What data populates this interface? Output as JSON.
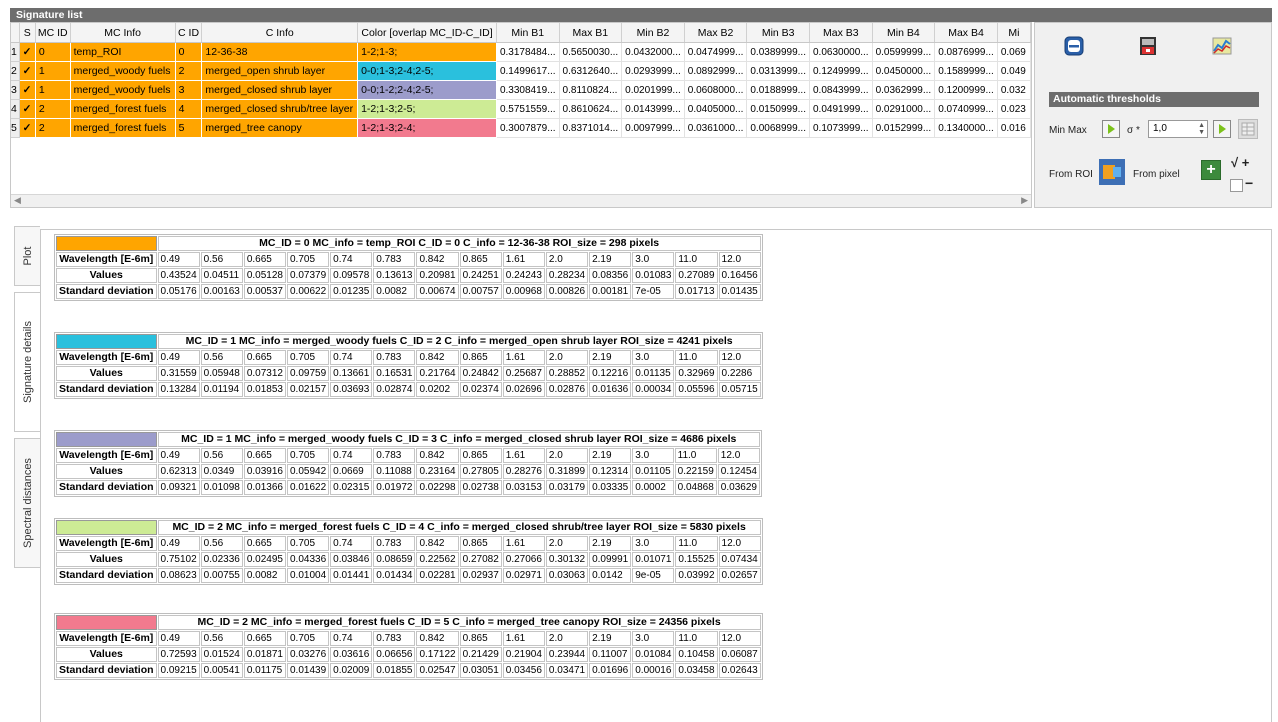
{
  "panel_title": "Signature list",
  "columns": [
    "S",
    "MC ID",
    "MC Info",
    "C ID",
    "C Info",
    "Color [overlap MC_ID-C_ID]",
    "Min B1",
    "Max B1",
    "Min B2",
    "Max B2",
    "Min B3",
    "Max B3",
    "Min B4",
    "Max B4",
    "Mi"
  ],
  "rows": [
    {
      "num": "1",
      "check": "✓",
      "mc_id": "0",
      "mc_info": "temp_ROI",
      "c_id": "0",
      "c_info": "12-36-38",
      "color_text": "1-2;1-3;",
      "color": "#ffa500",
      "mins": [
        "0.3178484...",
        "0.5650030...",
        "0.0432000...",
        "0.0474999...",
        "0.0389999...",
        "0.0630000...",
        "0.0599999...",
        "0.0876999...",
        "0.069"
      ]
    },
    {
      "num": "2",
      "check": "✓",
      "mc_id": "1",
      "mc_info": "merged_woody fuels",
      "c_id": "2",
      "c_info": "merged_open shrub layer",
      "color_text": "0-0;1-3;2-4;2-5;",
      "color": "#2ac0dd",
      "mins": [
        "0.1499617...",
        "0.6312640...",
        "0.0293999...",
        "0.0892999...",
        "0.0313999...",
        "0.1249999...",
        "0.0450000...",
        "0.1589999...",
        "0.049"
      ]
    },
    {
      "num": "3",
      "check": "✓",
      "mc_id": "1",
      "mc_info": "merged_woody fuels",
      "c_id": "3",
      "c_info": "merged_closed shrub layer",
      "color_text": "0-0;1-2;2-4;2-5;",
      "color": "#9c9ccb",
      "mins": [
        "0.3308419...",
        "0.8110824...",
        "0.0201999...",
        "0.0608000...",
        "0.0188999...",
        "0.0843999...",
        "0.0362999...",
        "0.1200999...",
        "0.032"
      ]
    },
    {
      "num": "4",
      "check": "✓",
      "mc_id": "2",
      "mc_info": "merged_forest fuels",
      "c_id": "4",
      "c_info": "merged_closed shrub/tree layer",
      "color_text": "1-2;1-3;2-5;",
      "color": "#cdeb95",
      "mins": [
        "0.5751559...",
        "0.8610624...",
        "0.0143999...",
        "0.0405000...",
        "0.0150999...",
        "0.0491999...",
        "0.0291000...",
        "0.0740999...",
        "0.023"
      ]
    },
    {
      "num": "5",
      "check": "✓",
      "mc_id": "2",
      "mc_info": "merged_forest fuels",
      "c_id": "5",
      "c_info": "merged_tree canopy",
      "color_text": "1-2;1-3;2-4;",
      "color": "#f27a8e",
      "mins": [
        "0.3007879...",
        "0.8371014...",
        "0.0097999...",
        "0.0361000...",
        "0.0068999...",
        "0.1073999...",
        "0.0152999...",
        "0.1340000...",
        "0.016"
      ]
    }
  ],
  "right_panel": {
    "auto_title": "Automatic thresholds",
    "min_max": "Min Max",
    "sigma": "σ *",
    "sigma_value": "1,0",
    "from_roi": "From ROI",
    "from_pixel": "From pixel",
    "check_mark": "√",
    "plus": "+",
    "minus": "−"
  },
  "tabs": [
    "Plot",
    "Signature details",
    "Spectral distances"
  ],
  "row_labels": {
    "wavelength": "Wavelength [E-6m]",
    "values": "Values",
    "std": "Standard deviation"
  },
  "details": [
    {
      "header": "MC_ID = 0 MC_info = temp_ROI C_ID = 0 C_info = 12-36-38 ROI_size = 298 pixels",
      "color": "#ffa500",
      "wavelengths": [
        "0.49",
        "0.56",
        "0.665",
        "0.705",
        "0.74",
        "0.783",
        "0.842",
        "0.865",
        "1.61",
        "2.0",
        "2.19",
        "3.0",
        "11.0",
        "12.0"
      ],
      "values": [
        "0.43524",
        "0.04511",
        "0.05128",
        "0.07379",
        "0.09578",
        "0.13613",
        "0.20981",
        "0.24251",
        "0.24243",
        "0.28234",
        "0.08356",
        "0.01083",
        "0.27089",
        "0.16456"
      ],
      "std": [
        "0.05176",
        "0.00163",
        "0.00537",
        "0.00622",
        "0.01235",
        "0.0082",
        "0.00674",
        "0.00757",
        "0.00968",
        "0.00826",
        "0.00181",
        "7e-05",
        "0.01713",
        "0.01435"
      ]
    },
    {
      "header": "MC_ID = 1 MC_info = merged_woody fuels C_ID = 2 C_info = merged_open shrub layer ROI_size = 4241 pixels",
      "color": "#2ac0dd",
      "wavelengths": [
        "0.49",
        "0.56",
        "0.665",
        "0.705",
        "0.74",
        "0.783",
        "0.842",
        "0.865",
        "1.61",
        "2.0",
        "2.19",
        "3.0",
        "11.0",
        "12.0"
      ],
      "values": [
        "0.31559",
        "0.05948",
        "0.07312",
        "0.09759",
        "0.13661",
        "0.16531",
        "0.21764",
        "0.24842",
        "0.25687",
        "0.28852",
        "0.12216",
        "0.01135",
        "0.32969",
        "0.2286"
      ],
      "std": [
        "0.13284",
        "0.01194",
        "0.01853",
        "0.02157",
        "0.03693",
        "0.02874",
        "0.0202",
        "0.02374",
        "0.02696",
        "0.02876",
        "0.01636",
        "0.00034",
        "0.05596",
        "0.05715"
      ]
    },
    {
      "header": "MC_ID = 1 MC_info = merged_woody fuels C_ID = 3 C_info = merged_closed shrub layer ROI_size = 4686 pixels",
      "color": "#9c9ccb",
      "wavelengths": [
        "0.49",
        "0.56",
        "0.665",
        "0.705",
        "0.74",
        "0.783",
        "0.842",
        "0.865",
        "1.61",
        "2.0",
        "2.19",
        "3.0",
        "11.0",
        "12.0"
      ],
      "values": [
        "0.62313",
        "0.0349",
        "0.03916",
        "0.05942",
        "0.0669",
        "0.11088",
        "0.23164",
        "0.27805",
        "0.28276",
        "0.31899",
        "0.12314",
        "0.01105",
        "0.22159",
        "0.12454"
      ],
      "std": [
        "0.09321",
        "0.01098",
        "0.01366",
        "0.01622",
        "0.02315",
        "0.01972",
        "0.02298",
        "0.02738",
        "0.03153",
        "0.03179",
        "0.03335",
        "0.0002",
        "0.04868",
        "0.03629"
      ]
    },
    {
      "header": "MC_ID = 2 MC_info = merged_forest fuels C_ID = 4 C_info = merged_closed shrub/tree layer ROI_size = 5830 pixels",
      "color": "#cdeb95",
      "wavelengths": [
        "0.49",
        "0.56",
        "0.665",
        "0.705",
        "0.74",
        "0.783",
        "0.842",
        "0.865",
        "1.61",
        "2.0",
        "2.19",
        "3.0",
        "11.0",
        "12.0"
      ],
      "values": [
        "0.75102",
        "0.02336",
        "0.02495",
        "0.04336",
        "0.03846",
        "0.08659",
        "0.22562",
        "0.27082",
        "0.27066",
        "0.30132",
        "0.09991",
        "0.01071",
        "0.15525",
        "0.07434"
      ],
      "std": [
        "0.08623",
        "0.00755",
        "0.0082",
        "0.01004",
        "0.01441",
        "0.01434",
        "0.02281",
        "0.02937",
        "0.02971",
        "0.03063",
        "0.0142",
        "9e-05",
        "0.03992",
        "0.02657"
      ]
    },
    {
      "header": "MC_ID = 2 MC_info = merged_forest fuels C_ID = 5 C_info = merged_tree canopy ROI_size = 24356 pixels",
      "color": "#f27a8e",
      "wavelengths": [
        "0.49",
        "0.56",
        "0.665",
        "0.705",
        "0.74",
        "0.783",
        "0.842",
        "0.865",
        "1.61",
        "2.0",
        "2.19",
        "3.0",
        "11.0",
        "12.0"
      ],
      "values": [
        "0.72593",
        "0.01524",
        "0.01871",
        "0.03276",
        "0.03616",
        "0.06656",
        "0.17122",
        "0.21429",
        "0.21904",
        "0.23944",
        "0.11007",
        "0.01084",
        "0.10458",
        "0.06087"
      ],
      "std": [
        "0.09215",
        "0.00541",
        "0.01175",
        "0.01439",
        "0.02009",
        "0.01855",
        "0.02547",
        "0.03051",
        "0.03456",
        "0.03471",
        "0.01696",
        "0.00016",
        "0.03458",
        "0.02643"
      ]
    }
  ]
}
